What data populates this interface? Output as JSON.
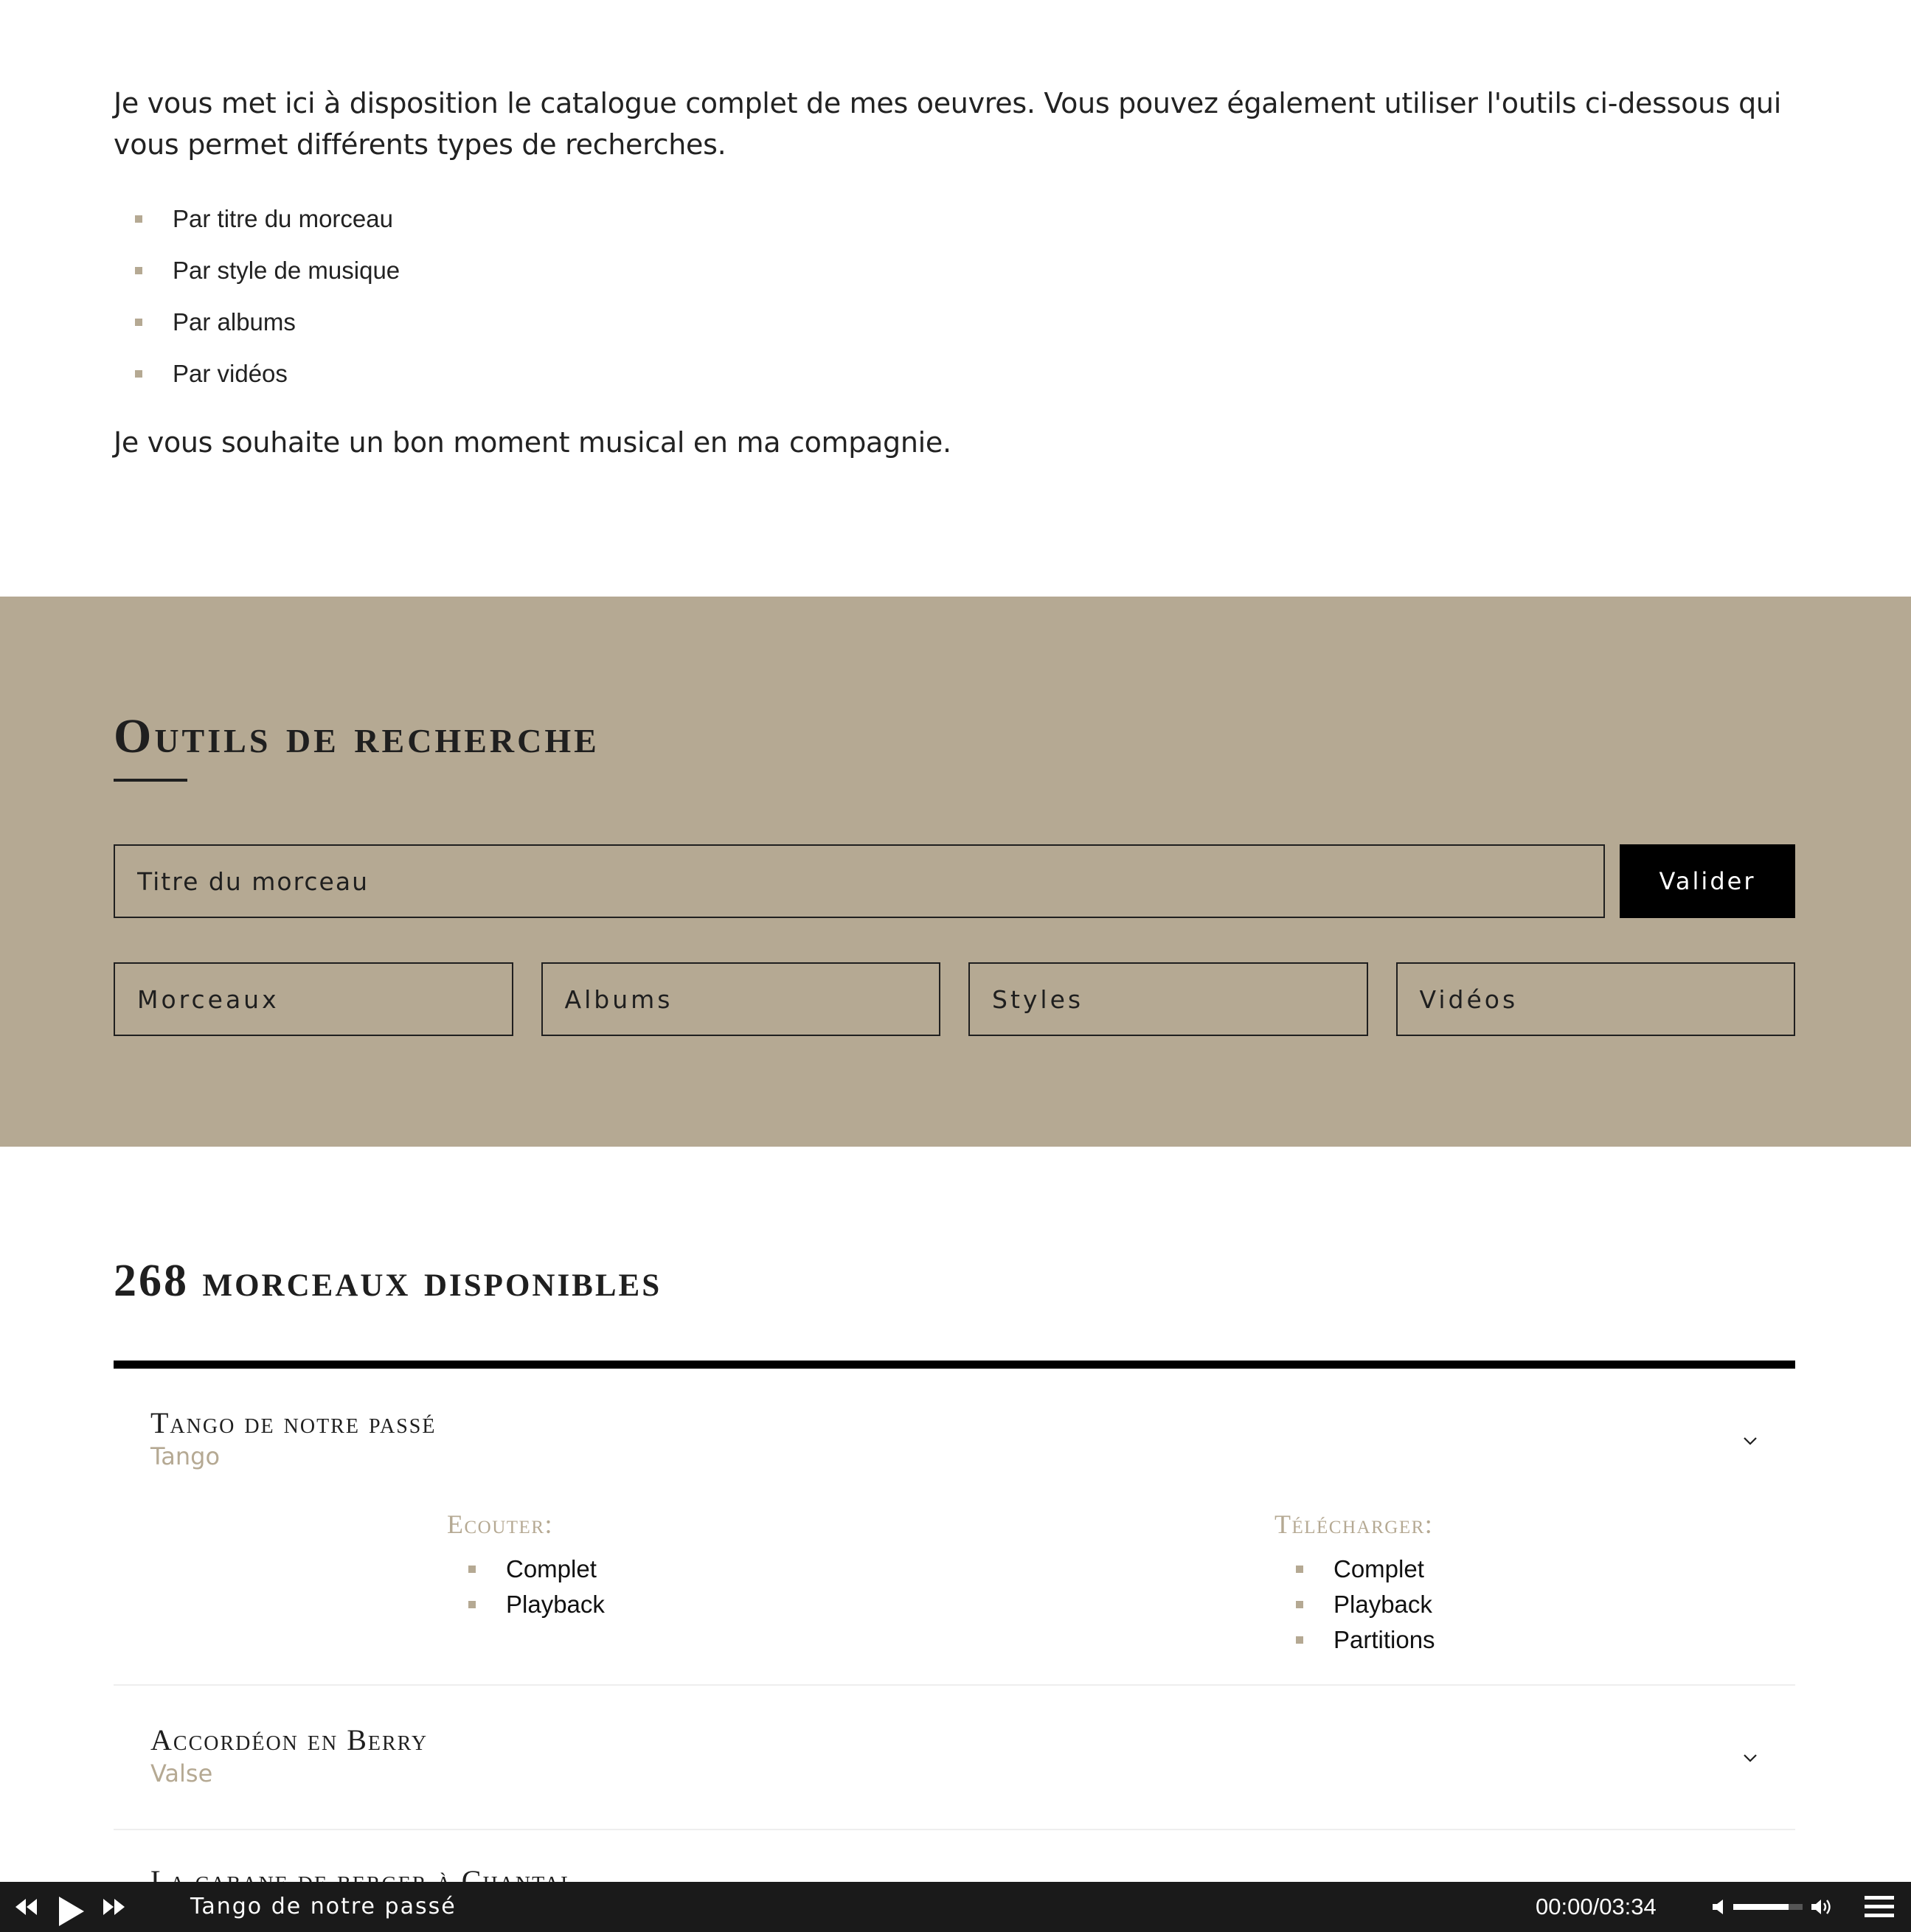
{
  "intro": {
    "text": "Je vous met ici à disposition le catalogue complet de mes oeuvres. Vous pouvez également utiliser l'outils ci-dessous qui vous permet différents types de recherches.",
    "list": [
      "Par titre du morceau",
      "Par style de musique",
      "Par albums",
      "Par vidéos"
    ],
    "outro": "Je vous souhaite un bon moment musical en ma compagnie."
  },
  "tools": {
    "title": "Outils de recherche",
    "search_placeholder": "Titre du morceau",
    "submit_label": "Valider",
    "filters": [
      "Morceaux",
      "Albums",
      "Styles",
      "Vidéos"
    ]
  },
  "results": {
    "title": "268 morceaux disponibles",
    "tracks": [
      {
        "title": "Tango de notre passé",
        "style": "Tango",
        "listen_heading": "Ecouter:",
        "listen": [
          "Complet",
          "Playback"
        ],
        "download_heading": "Télécharger:",
        "download": [
          "Complet",
          "Playback",
          "Partitions"
        ]
      },
      {
        "title": "Accordéon en Berry",
        "style": "Valse"
      },
      {
        "title": "La cabane de berger à Chantal"
      }
    ]
  },
  "player": {
    "now_playing": "Tango de notre passé",
    "current_time": "00:00",
    "separator": "/",
    "duration": "03:34",
    "volume": 0.8,
    "icons": [
      "rewind-icon",
      "play-icon",
      "fast-forward-icon",
      "volume-mute-icon",
      "volume-max-icon",
      "playlist-menu-icon"
    ]
  },
  "colors": {
    "accent": "#b5a993",
    "band_background": "#b5a993",
    "button_dark": "#000000",
    "player_background": "#1a1a1a"
  }
}
